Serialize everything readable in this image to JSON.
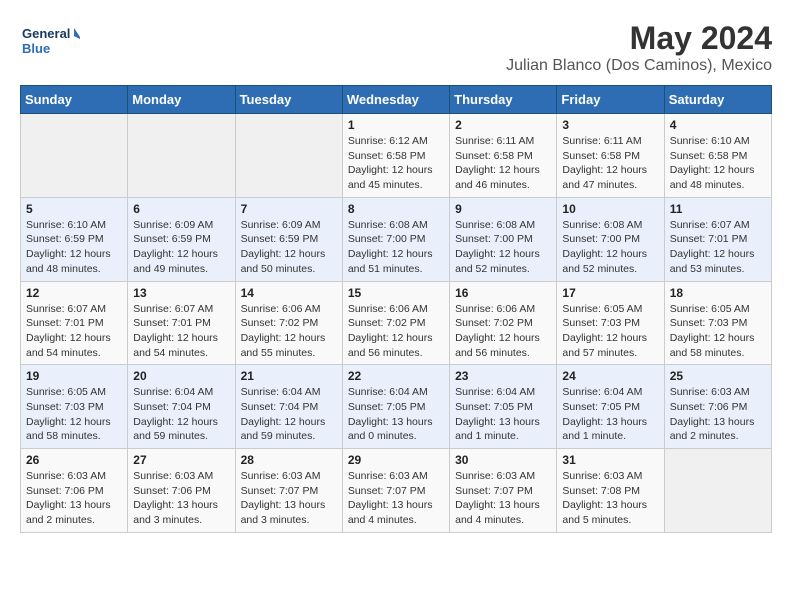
{
  "header": {
    "logo_line1": "General",
    "logo_line2": "Blue",
    "main_title": "May 2024",
    "subtitle": "Julian Blanco (Dos Caminos), Mexico"
  },
  "weekdays": [
    "Sunday",
    "Monday",
    "Tuesday",
    "Wednesday",
    "Thursday",
    "Friday",
    "Saturday"
  ],
  "weeks": [
    [
      {
        "day": "",
        "info": ""
      },
      {
        "day": "",
        "info": ""
      },
      {
        "day": "",
        "info": ""
      },
      {
        "day": "1",
        "info": "Sunrise: 6:12 AM\nSunset: 6:58 PM\nDaylight: 12 hours\nand 45 minutes."
      },
      {
        "day": "2",
        "info": "Sunrise: 6:11 AM\nSunset: 6:58 PM\nDaylight: 12 hours\nand 46 minutes."
      },
      {
        "day": "3",
        "info": "Sunrise: 6:11 AM\nSunset: 6:58 PM\nDaylight: 12 hours\nand 47 minutes."
      },
      {
        "day": "4",
        "info": "Sunrise: 6:10 AM\nSunset: 6:58 PM\nDaylight: 12 hours\nand 48 minutes."
      }
    ],
    [
      {
        "day": "5",
        "info": "Sunrise: 6:10 AM\nSunset: 6:59 PM\nDaylight: 12 hours\nand 48 minutes."
      },
      {
        "day": "6",
        "info": "Sunrise: 6:09 AM\nSunset: 6:59 PM\nDaylight: 12 hours\nand 49 minutes."
      },
      {
        "day": "7",
        "info": "Sunrise: 6:09 AM\nSunset: 6:59 PM\nDaylight: 12 hours\nand 50 minutes."
      },
      {
        "day": "8",
        "info": "Sunrise: 6:08 AM\nSunset: 7:00 PM\nDaylight: 12 hours\nand 51 minutes."
      },
      {
        "day": "9",
        "info": "Sunrise: 6:08 AM\nSunset: 7:00 PM\nDaylight: 12 hours\nand 52 minutes."
      },
      {
        "day": "10",
        "info": "Sunrise: 6:08 AM\nSunset: 7:00 PM\nDaylight: 12 hours\nand 52 minutes."
      },
      {
        "day": "11",
        "info": "Sunrise: 6:07 AM\nSunset: 7:01 PM\nDaylight: 12 hours\nand 53 minutes."
      }
    ],
    [
      {
        "day": "12",
        "info": "Sunrise: 6:07 AM\nSunset: 7:01 PM\nDaylight: 12 hours\nand 54 minutes."
      },
      {
        "day": "13",
        "info": "Sunrise: 6:07 AM\nSunset: 7:01 PM\nDaylight: 12 hours\nand 54 minutes."
      },
      {
        "day": "14",
        "info": "Sunrise: 6:06 AM\nSunset: 7:02 PM\nDaylight: 12 hours\nand 55 minutes."
      },
      {
        "day": "15",
        "info": "Sunrise: 6:06 AM\nSunset: 7:02 PM\nDaylight: 12 hours\nand 56 minutes."
      },
      {
        "day": "16",
        "info": "Sunrise: 6:06 AM\nSunset: 7:02 PM\nDaylight: 12 hours\nand 56 minutes."
      },
      {
        "day": "17",
        "info": "Sunrise: 6:05 AM\nSunset: 7:03 PM\nDaylight: 12 hours\nand 57 minutes."
      },
      {
        "day": "18",
        "info": "Sunrise: 6:05 AM\nSunset: 7:03 PM\nDaylight: 12 hours\nand 58 minutes."
      }
    ],
    [
      {
        "day": "19",
        "info": "Sunrise: 6:05 AM\nSunset: 7:03 PM\nDaylight: 12 hours\nand 58 minutes."
      },
      {
        "day": "20",
        "info": "Sunrise: 6:04 AM\nSunset: 7:04 PM\nDaylight: 12 hours\nand 59 minutes."
      },
      {
        "day": "21",
        "info": "Sunrise: 6:04 AM\nSunset: 7:04 PM\nDaylight: 12 hours\nand 59 minutes."
      },
      {
        "day": "22",
        "info": "Sunrise: 6:04 AM\nSunset: 7:05 PM\nDaylight: 13 hours\nand 0 minutes."
      },
      {
        "day": "23",
        "info": "Sunrise: 6:04 AM\nSunset: 7:05 PM\nDaylight: 13 hours\nand 1 minute."
      },
      {
        "day": "24",
        "info": "Sunrise: 6:04 AM\nSunset: 7:05 PM\nDaylight: 13 hours\nand 1 minute."
      },
      {
        "day": "25",
        "info": "Sunrise: 6:03 AM\nSunset: 7:06 PM\nDaylight: 13 hours\nand 2 minutes."
      }
    ],
    [
      {
        "day": "26",
        "info": "Sunrise: 6:03 AM\nSunset: 7:06 PM\nDaylight: 13 hours\nand 2 minutes."
      },
      {
        "day": "27",
        "info": "Sunrise: 6:03 AM\nSunset: 7:06 PM\nDaylight: 13 hours\nand 3 minutes."
      },
      {
        "day": "28",
        "info": "Sunrise: 6:03 AM\nSunset: 7:07 PM\nDaylight: 13 hours\nand 3 minutes."
      },
      {
        "day": "29",
        "info": "Sunrise: 6:03 AM\nSunset: 7:07 PM\nDaylight: 13 hours\nand 4 minutes."
      },
      {
        "day": "30",
        "info": "Sunrise: 6:03 AM\nSunset: 7:07 PM\nDaylight: 13 hours\nand 4 minutes."
      },
      {
        "day": "31",
        "info": "Sunrise: 6:03 AM\nSunset: 7:08 PM\nDaylight: 13 hours\nand 5 minutes."
      },
      {
        "day": "",
        "info": ""
      }
    ]
  ]
}
